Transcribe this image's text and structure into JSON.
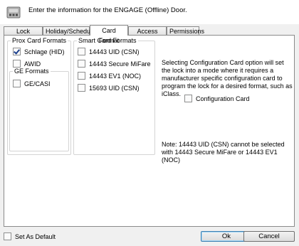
{
  "header": {
    "text": "Enter the information for the ENGAGE (Offline) Door."
  },
  "tabs": [
    {
      "label": "Lock Settings",
      "active": false
    },
    {
      "label": "Holiday/Schedule",
      "active": false
    },
    {
      "label": "Card Format",
      "active": true
    },
    {
      "label": "Access Group",
      "active": false
    },
    {
      "label": "Permissions",
      "active": false
    }
  ],
  "prox": {
    "title": "Prox Card Formats",
    "options": [
      {
        "label": "Schlage (HID)",
        "checked": true
      },
      {
        "label": "AWID",
        "checked": false
      }
    ]
  },
  "ge": {
    "title": "GE Formats",
    "options": [
      {
        "label": "GE/CASI",
        "checked": false
      }
    ]
  },
  "smart": {
    "title": "Smart Card Formats",
    "options": [
      {
        "label": "14443 UID (CSN)",
        "checked": false
      },
      {
        "label": "14443 Secure MiFare",
        "checked": false
      },
      {
        "label": "14443 EV1 (NOC)",
        "checked": false
      },
      {
        "label": "15693 UID (CSN)",
        "checked": false
      }
    ]
  },
  "config": {
    "info": "Selecting Configuration Card option will set the lock into a mode where it requires a manufacturer specific configuration card to program the lock for a desired format, such as iClass.",
    "checkbox_label": "Configuration Card",
    "checked": false
  },
  "note": "Note: 14443 UID (CSN) cannot be selected with 14443 Secure MiFare or 14443 EV1 (NOC)",
  "footer": {
    "set_default_label": "Set As Default",
    "set_default_checked": false,
    "ok_label": "Ok",
    "cancel_label": "Cancel"
  }
}
